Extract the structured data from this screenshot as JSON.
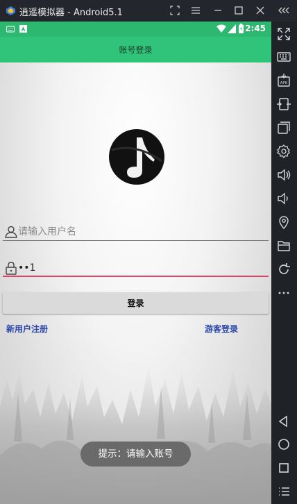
{
  "window": {
    "title": "逍遥模拟器 - Android5.1",
    "controls": [
      "screenshot-icon",
      "menu-icon",
      "minimize-icon",
      "maximize-icon",
      "close-icon",
      "collapse-icon"
    ],
    "accent": "#2fc47a"
  },
  "statusbar": {
    "time": "2:45"
  },
  "actionbar": {
    "title": "账号登录"
  },
  "login": {
    "username_placeholder": "请输入用户名",
    "username_value": "",
    "password_value": "••1",
    "login_button": "登录",
    "register_link": "新用户注册",
    "guest_link": "游客登录"
  },
  "toast": {
    "text": "提示：请输入账号"
  },
  "sidebar": {
    "icons": [
      "fullscreen-icon",
      "keyboard-icon",
      "apk-install-icon",
      "screen-rotate-icon",
      "multi-window-icon",
      "settings-icon",
      "volume-up-icon",
      "volume-down-icon",
      "location-icon",
      "folder-icon",
      "refresh-icon",
      "more-icon",
      "back-icon",
      "home-icon",
      "recent-apps-icon",
      "list-icon"
    ]
  }
}
